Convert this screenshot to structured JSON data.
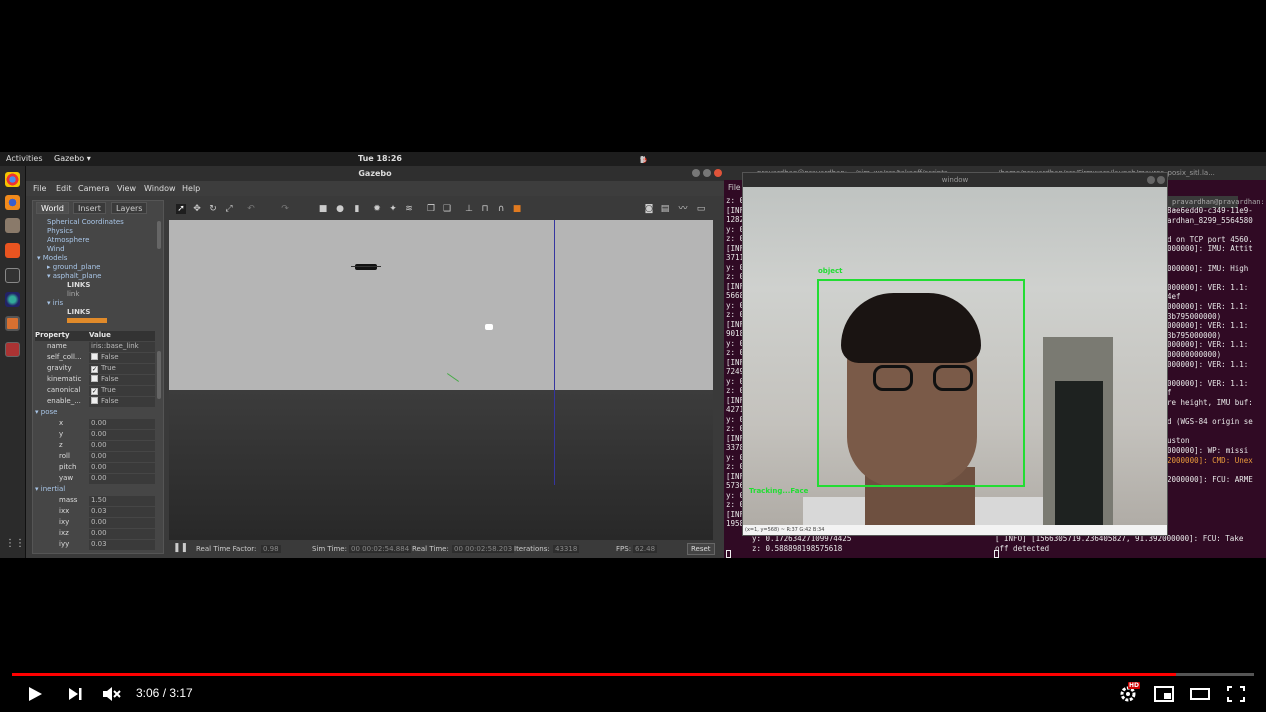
{
  "system": {
    "activities": "Activities",
    "app_menu": "Gazebo ▾",
    "clock": "Tue 18:26"
  },
  "gazebo": {
    "window_title": "Gazebo",
    "menu": [
      "File",
      "Edit",
      "Camera",
      "View",
      "Window",
      "Help"
    ],
    "tabs": [
      "World",
      "Insert",
      "Layers"
    ],
    "tree": [
      "Spherical Coordinates",
      "Physics",
      "Atmosphere",
      "Wind",
      "Models",
      "ground_plane",
      "asphalt_plane",
      "LINKS",
      "link",
      "iris",
      "LINKS"
    ],
    "props_header": [
      "Property",
      "Value"
    ],
    "props": [
      {
        "k": "name",
        "v": "iris::base_link"
      },
      {
        "k": "self_coll...",
        "v": "False"
      },
      {
        "k": "gravity",
        "v": "True"
      },
      {
        "k": "kinematic",
        "v": "False"
      },
      {
        "k": "canonical",
        "v": "True"
      },
      {
        "k": "enable_...",
        "v": "False"
      },
      {
        "k": "pose",
        "v": ""
      },
      {
        "k": "x",
        "v": "0.00"
      },
      {
        "k": "y",
        "v": "0.00"
      },
      {
        "k": "z",
        "v": "0.00"
      },
      {
        "k": "roll",
        "v": "0.00"
      },
      {
        "k": "pitch",
        "v": "0.00"
      },
      {
        "k": "yaw",
        "v": "0.00"
      },
      {
        "k": "inertial",
        "v": ""
      },
      {
        "k": "mass",
        "v": "1.50"
      },
      {
        "k": "ixx",
        "v": "0.03"
      },
      {
        "k": "ixy",
        "v": "0.00"
      },
      {
        "k": "ixz",
        "v": "0.00"
      },
      {
        "k": "iyy",
        "v": "0.03"
      }
    ],
    "status": {
      "rtf_label": "Real Time Factor:",
      "rtf": "0.98",
      "sim_label": "Sim Time:",
      "sim": "00 00:02:54.884",
      "real_label": "Real Time:",
      "real": "00 00:02:58.203",
      "iter_label": "Iterations:",
      "iter": "43318",
      "fps_label": "FPS:",
      "fps": "62.48",
      "reset": "Reset"
    }
  },
  "terminal": {
    "title_left": "pravardhan@pravardhan: ~/sim_ws/src/takeoff/scripts",
    "title_right": "/home/pravardhan/src/Firmware/launch/mavros_posix_sitl.la...",
    "file_menu": "File",
    "tab_label": "pravardhan@pravardhan: ~",
    "left_lines": [
      "z: 0",
      "[INFO",
      "1282",
      "y: 0",
      "z: 0",
      "[INFO",
      "3711",
      "y: 0",
      "z: 0",
      "[INFO",
      "5668",
      "y: 0",
      "z: 0",
      "[INFO",
      "9018",
      "y: 0",
      "z: 0",
      "[INFO",
      "7249",
      "y: 0",
      "z: 0",
      "[INFO",
      "4271",
      "y: 0",
      "z: 0",
      "[INFO",
      "3378",
      "y: 0",
      "z: 0",
      "[INFO",
      "5736",
      "y: 0",
      "z: 0",
      "[INFO",
      "1958"
    ],
    "right_lines": [
      "8ae6edd0-c349-11e9-",
      "ardhan_8299_5564580",
      "",
      "d on TCP port 4560.",
      "000000]: IMU: Attit",
      "",
      "000000]: IMU: High",
      "",
      "000000]: VER: 1.1:",
      "4ef",
      "000000]: VER: 1.1:",
      "3b795000000)",
      "000000]: VER: 1.1:",
      "3b795000000)",
      "000000]: VER: 1.1:",
      "00000000000)",
      "000000]: VER: 1.1:",
      "",
      "000000]: VER: 1.1:",
      "f",
      "re height, IMU buf:",
      "",
      "d (WGS-84 origin se",
      "",
      "uston",
      "000000]: WP: missi",
      "2000000]: CMD: Unex",
      "",
      "2000000]: FCU: ARME"
    ],
    "bottom_y": "y: 0.17263427109974425",
    "bottom_z": "z: 0.588898198575618",
    "bottom_info": "[ INFO] [1566305719.236405827, 91.392000000]: FCU: Take",
    "bottom_info2": "off detected"
  },
  "camera_window": {
    "title": "window",
    "box_label": "object",
    "tracking_label": "Tracking...Face",
    "status_text": "(x=1, y=568) ~ R:37 G:42 B:34"
  },
  "player": {
    "time": "3:06 / 3:17",
    "progress": 0.9369,
    "hd_badge": "HD"
  }
}
